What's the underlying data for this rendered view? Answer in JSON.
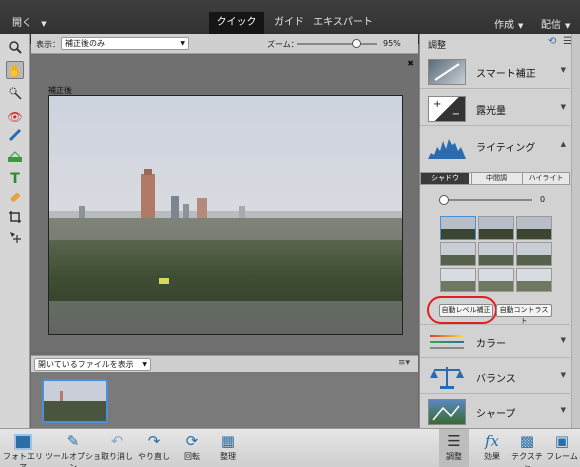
{
  "topbar": {
    "open_label": "開く",
    "tabs": [
      {
        "label": "クイック",
        "active": true
      },
      {
        "label": "ガイド",
        "active": false
      },
      {
        "label": "エキスパート",
        "active": false
      }
    ],
    "create_label": "作成",
    "share_label": "配信"
  },
  "options": {
    "view_label": "表示：",
    "view_value": "補正後のみ",
    "zoom_label": "ズーム：",
    "zoom_value": "95%",
    "zoom_fraction": 0.35
  },
  "canvas": {
    "close_glyph": "✖",
    "image_caption": "補正後"
  },
  "bin": {
    "dropdown_value": "開いているファイルを表示"
  },
  "panel": {
    "title": "調整",
    "sections": [
      {
        "label": "スマート補正",
        "expanded": false
      },
      {
        "label": "露光量",
        "expanded": false
      },
      {
        "label": "ライティング",
        "expanded": true
      },
      {
        "label": "カラー",
        "expanded": false
      },
      {
        "label": "バランス",
        "expanded": false
      },
      {
        "label": "シャープ",
        "expanded": false
      }
    ],
    "lighting": {
      "subtabs": [
        "シャドウ",
        "中間調",
        "ハイライト"
      ],
      "active_subtab": 0,
      "slider_value": "0",
      "slider_fraction": 0.0,
      "auto_levels_label": "自動レベル補正",
      "auto_contrast_label": "自動コントラスト"
    }
  },
  "bottombar": {
    "left": [
      {
        "label": "フォトエリア",
        "icon": "photo-bin-icon"
      },
      {
        "label": "ツールオプション",
        "icon": "tool-options-icon"
      },
      {
        "label": "取り消し",
        "icon": "undo-icon"
      },
      {
        "label": "やり直し",
        "icon": "redo-icon"
      },
      {
        "label": "回転",
        "icon": "rotate-icon"
      },
      {
        "label": "整理",
        "icon": "organizer-icon"
      }
    ],
    "right": [
      {
        "label": "調整",
        "icon": "adjust-icon"
      },
      {
        "label": "効果",
        "icon": "fx-icon"
      },
      {
        "label": "テクスチャ",
        "icon": "texture-icon"
      },
      {
        "label": "フレーム",
        "icon": "frame-icon"
      }
    ]
  },
  "colors": {
    "accent": "#4a90d9",
    "highlight_ring": "#e02020"
  }
}
